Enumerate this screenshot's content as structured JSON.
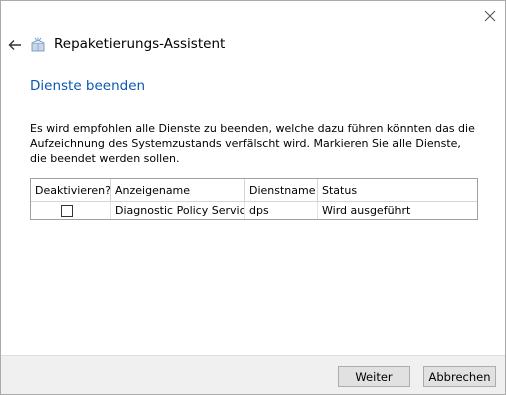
{
  "window": {
    "close_icon": "close-icon"
  },
  "header": {
    "back_icon": "back-arrow-icon",
    "app_icon": "package-icon",
    "title": "Repaketierungs-Assistent"
  },
  "section": {
    "heading": "Dienste beenden",
    "description": "Es wird empfohlen alle Dienste zu beenden, welche dazu führen könnten das die Aufzeichnung des Systemzustands verfälscht wird. Markieren Sie alle Dienste, die beendet werden sollen."
  },
  "services_table": {
    "columns": [
      "Deaktivieren?",
      "Anzeigename",
      "Dienstname",
      "Status"
    ],
    "rows": [
      {
        "deactivate": false,
        "display_name": "Diagnostic Policy Service",
        "service_name": "dps",
        "status": "Wird ausgeführt"
      }
    ]
  },
  "footer": {
    "next_label": "Weiter",
    "cancel_label": "Abbrechen"
  },
  "colors": {
    "accent": "#0a58b4",
    "footer_bg": "#f0f0f0",
    "button_bg": "#e1e1e1"
  }
}
